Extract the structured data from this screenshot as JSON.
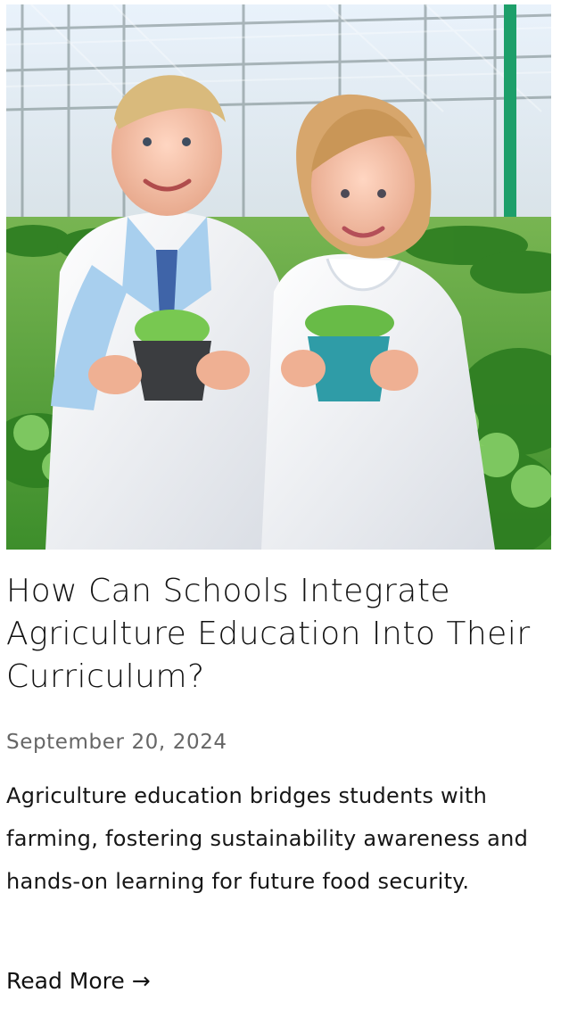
{
  "post": {
    "title": "How Can Schools Integrate Agriculture Education Into Their Curriculum?",
    "date": "September 20, 2024",
    "excerpt": "Agriculture education bridges students with farming, fostering sustainability awareness and hands-on learning for future food security.",
    "read_more": "Read More",
    "read_more_arrow": "→"
  },
  "image": {
    "description_icon": "greenhouse-children-photo",
    "alt": "How Can Schools Integrate Agriculture Education Into Their Curriculum?"
  },
  "colors": {
    "text": "#111111",
    "date": "#666666",
    "greenhouse_green": "#4f9f35",
    "lab_coat_white": "#f3f5f7"
  }
}
